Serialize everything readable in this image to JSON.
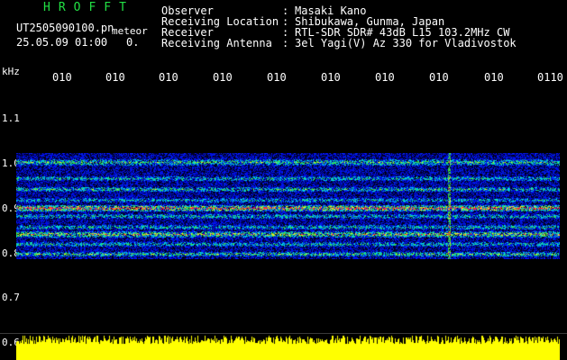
{
  "header": {
    "brand": "HROFFT",
    "filename": "UT2505090100.pn",
    "suffix": "meteor",
    "timestamp": "25.05.09 01:00",
    "count": "0.",
    "fields": [
      {
        "label": "Observer",
        "sep": ":",
        "value": "Masaki Kano"
      },
      {
        "label": "Receiving Location",
        "sep": ":",
        "value": "Shibukawa, Gunma, Japan"
      },
      {
        "label": "Receiver",
        "sep": ":",
        "value": "RTL-SDR SDR# 43dB L15 103.2MHz CW"
      },
      {
        "label": "Receiving Antenna",
        "sep": ":",
        "value": "3el Yagi(V) Az 330 for Vladivostok"
      }
    ]
  },
  "axis": {
    "unit": "kHz",
    "time_ticks": [
      "010",
      "010",
      "010",
      "010",
      "010",
      "010",
      "010",
      "010",
      "010",
      "0110"
    ],
    "freq_ticks": [
      "1.1",
      "1.0",
      "0.9",
      "0.8",
      "0.7",
      "0.6"
    ]
  },
  "colors": {
    "brand": "#22e044",
    "text": "#ffffff",
    "background": "#000000",
    "noise_blue": "#1a2cff",
    "band_red": "#ff1e3c",
    "spectrum_yellow": "#ffff00"
  }
}
